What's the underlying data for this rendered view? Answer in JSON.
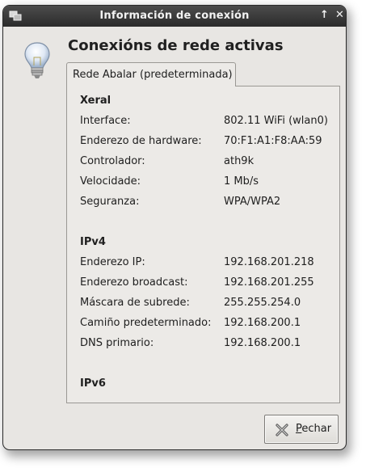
{
  "window": {
    "title": "Información de conexión",
    "titlebar_buttons": [
      "↑",
      "✕"
    ]
  },
  "heading": "Conexións de rede activas",
  "tab": {
    "label": "Rede Abalar (predeterminada)"
  },
  "general": {
    "title": "Xeral",
    "rows": [
      {
        "label": "Interface:",
        "value": "802.11 WiFi (wlan0)"
      },
      {
        "label": "Enderezo de hardware:",
        "value": "70:F1:A1:F8:AA:59"
      },
      {
        "label": "Controlador:",
        "value": "ath9k"
      },
      {
        "label": "Velocidade:",
        "value": "1 Mb/s"
      },
      {
        "label": "Seguranza:",
        "value": "WPA/WPA2"
      }
    ]
  },
  "ipv4": {
    "title": "IPv4",
    "rows": [
      {
        "label": "Enderezo IP:",
        "value": "192.168.201.218"
      },
      {
        "label": "Enderezo broadcast:",
        "value": "192.168.201.255"
      },
      {
        "label": "Máscara de subrede:",
        "value": "255.255.254.0"
      },
      {
        "label": "Camiño predeterminado:",
        "value": "192.168.200.1"
      },
      {
        "label": "DNS primario:",
        "value": "192.168.200.1"
      }
    ]
  },
  "ipv6": {
    "title": "IPv6"
  },
  "close_button": {
    "mnemonic": "P",
    "rest": "echar"
  },
  "icons": {
    "app": "network-icon",
    "info": "lightbulb-icon",
    "close": "close-x-icon"
  }
}
